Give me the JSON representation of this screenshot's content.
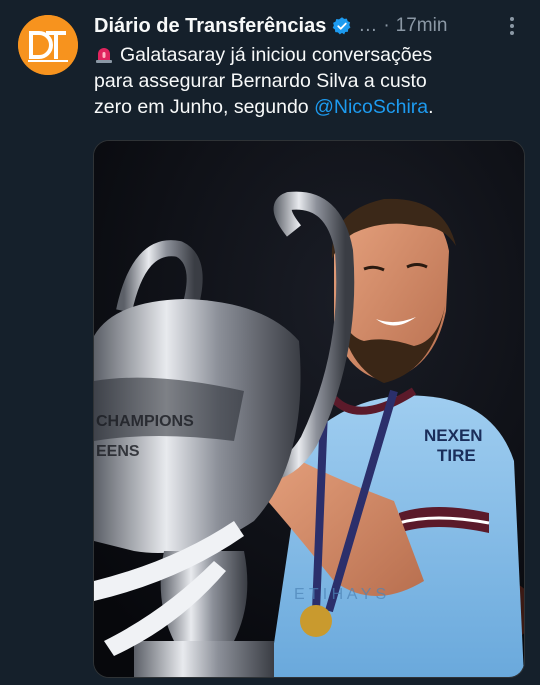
{
  "tweet": {
    "author_name": "Diário de Transferências",
    "handle_truncated": "…",
    "separator": "·",
    "time": "17min",
    "text_line1": "Galatasaray já iniciou conversações",
    "text_line2": "para assegurar Bernardo Silva a custo",
    "text_line3_before": "zero em Junho, segundo ",
    "mention": "@NicoSchira",
    "text_line3_after": ".",
    "avatar_initials": "DT"
  },
  "media": {
    "trophy_text": "CHAMPIONS",
    "trophy_text2": "EENS",
    "shirt_sponsor_line1": "NEXEN",
    "shirt_sponsor_line2": "TIRE",
    "shirt_lower_text": "E T I H A Y S"
  },
  "colors": {
    "background": "#15202b",
    "accent": "#1d9bf0",
    "avatar": "#f7931e",
    "secondary_text": "#8b98a5"
  }
}
